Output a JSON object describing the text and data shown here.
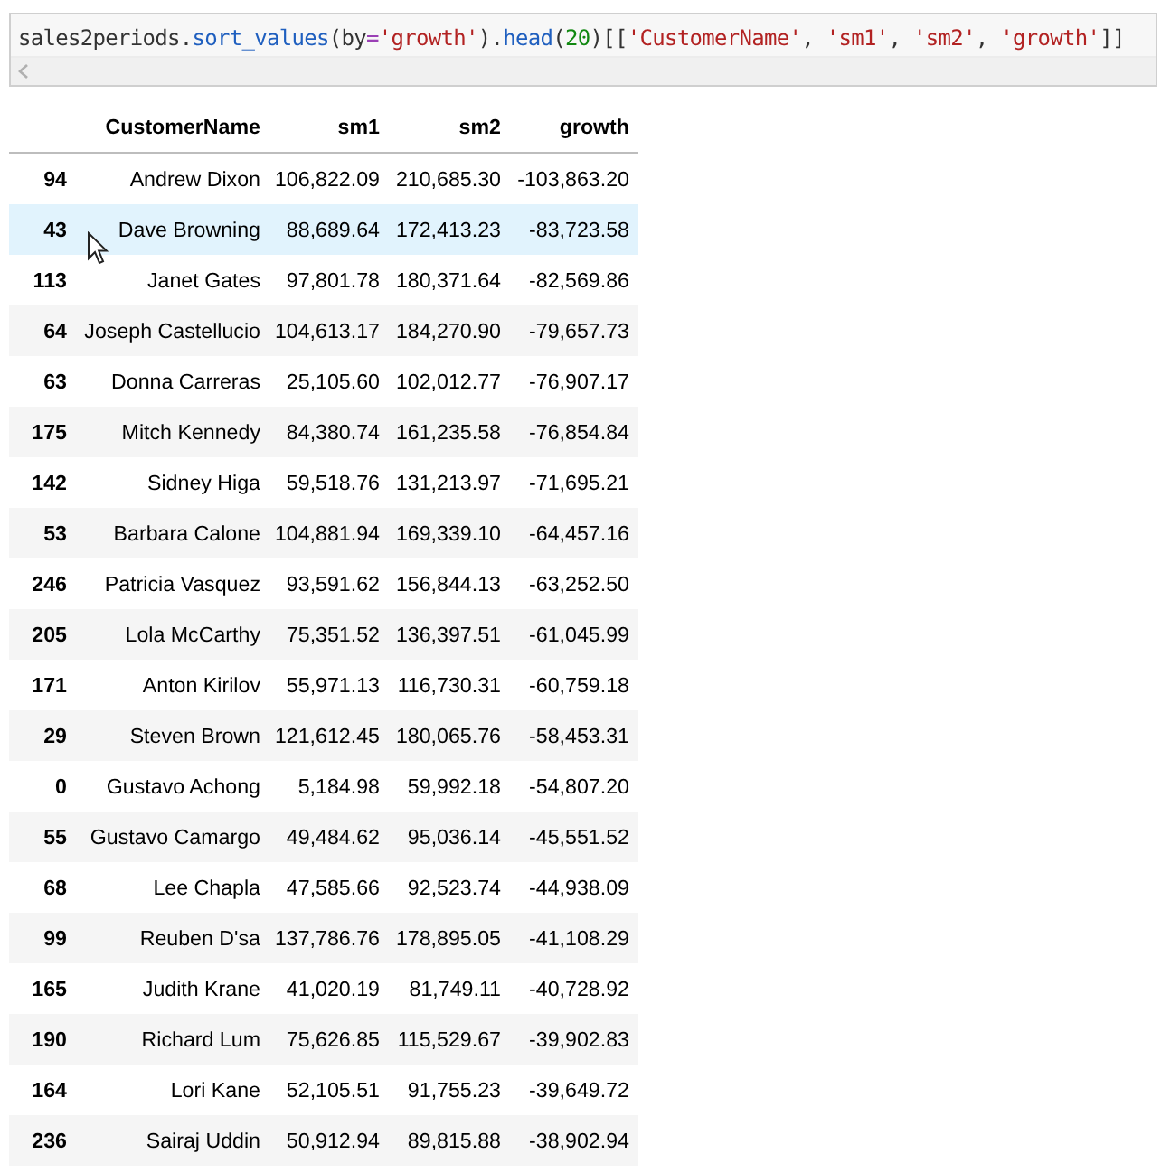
{
  "code_cell": {
    "tokens": [
      {
        "kind": "plain",
        "text": "sales2periods."
      },
      {
        "kind": "function",
        "text": "sort_values"
      },
      {
        "kind": "plain",
        "text": "(by"
      },
      {
        "kind": "operator",
        "text": "="
      },
      {
        "kind": "string",
        "text": "'growth'"
      },
      {
        "kind": "plain",
        "text": ")."
      },
      {
        "kind": "function",
        "text": "head"
      },
      {
        "kind": "plain",
        "text": "("
      },
      {
        "kind": "number",
        "text": "20"
      },
      {
        "kind": "plain",
        "text": ")[["
      },
      {
        "kind": "string",
        "text": "'CustomerName'"
      },
      {
        "kind": "plain",
        "text": ", "
      },
      {
        "kind": "string",
        "text": "'sm1'"
      },
      {
        "kind": "plain",
        "text": ", "
      },
      {
        "kind": "string",
        "text": "'sm2'"
      },
      {
        "kind": "plain",
        "text": ", "
      },
      {
        "kind": "string",
        "text": "'growth'"
      },
      {
        "kind": "plain",
        "text": "]]"
      }
    ]
  },
  "table": {
    "columns": [
      "CustomerName",
      "sm1",
      "sm2",
      "growth"
    ],
    "rows": [
      {
        "index": "94",
        "cells": [
          "Andrew Dixon",
          "106,822.09",
          "210,685.30",
          "-103,863.20"
        ],
        "hovered": false
      },
      {
        "index": "43",
        "cells": [
          "Dave Browning",
          "88,689.64",
          "172,413.23",
          "-83,723.58"
        ],
        "hovered": true
      },
      {
        "index": "113",
        "cells": [
          "Janet Gates",
          "97,801.78",
          "180,371.64",
          "-82,569.86"
        ],
        "hovered": false
      },
      {
        "index": "64",
        "cells": [
          "Joseph Castellucio",
          "104,613.17",
          "184,270.90",
          "-79,657.73"
        ],
        "hovered": false
      },
      {
        "index": "63",
        "cells": [
          "Donna Carreras",
          "25,105.60",
          "102,012.77",
          "-76,907.17"
        ],
        "hovered": false
      },
      {
        "index": "175",
        "cells": [
          "Mitch Kennedy",
          "84,380.74",
          "161,235.58",
          "-76,854.84"
        ],
        "hovered": false
      },
      {
        "index": "142",
        "cells": [
          "Sidney Higa",
          "59,518.76",
          "131,213.97",
          "-71,695.21"
        ],
        "hovered": false
      },
      {
        "index": "53",
        "cells": [
          "Barbara Calone",
          "104,881.94",
          "169,339.10",
          "-64,457.16"
        ],
        "hovered": false
      },
      {
        "index": "246",
        "cells": [
          "Patricia Vasquez",
          "93,591.62",
          "156,844.13",
          "-63,252.50"
        ],
        "hovered": false
      },
      {
        "index": "205",
        "cells": [
          "Lola McCarthy",
          "75,351.52",
          "136,397.51",
          "-61,045.99"
        ],
        "hovered": false
      },
      {
        "index": "171",
        "cells": [
          "Anton Kirilov",
          "55,971.13",
          "116,730.31",
          "-60,759.18"
        ],
        "hovered": false
      },
      {
        "index": "29",
        "cells": [
          "Steven Brown",
          "121,612.45",
          "180,065.76",
          "-58,453.31"
        ],
        "hovered": false
      },
      {
        "index": "0",
        "cells": [
          "Gustavo Achong",
          "5,184.98",
          "59,992.18",
          "-54,807.20"
        ],
        "hovered": false
      },
      {
        "index": "55",
        "cells": [
          "Gustavo Camargo",
          "49,484.62",
          "95,036.14",
          "-45,551.52"
        ],
        "hovered": false
      },
      {
        "index": "68",
        "cells": [
          "Lee Chapla",
          "47,585.66",
          "92,523.74",
          "-44,938.09"
        ],
        "hovered": false
      },
      {
        "index": "99",
        "cells": [
          "Reuben D'sa",
          "137,786.76",
          "178,895.05",
          "-41,108.29"
        ],
        "hovered": false
      },
      {
        "index": "165",
        "cells": [
          "Judith Krane",
          "41,020.19",
          "81,749.11",
          "-40,728.92"
        ],
        "hovered": false
      },
      {
        "index": "190",
        "cells": [
          "Richard Lum",
          "75,626.85",
          "115,529.67",
          "-39,902.83"
        ],
        "hovered": false
      },
      {
        "index": "164",
        "cells": [
          "Lori Kane",
          "52,105.51",
          "91,755.23",
          "-39,649.72"
        ],
        "hovered": false
      },
      {
        "index": "236",
        "cells": [
          "Sairaj Uddin",
          "50,912.94",
          "89,815.88",
          "-38,902.94"
        ],
        "hovered": false
      }
    ]
  }
}
